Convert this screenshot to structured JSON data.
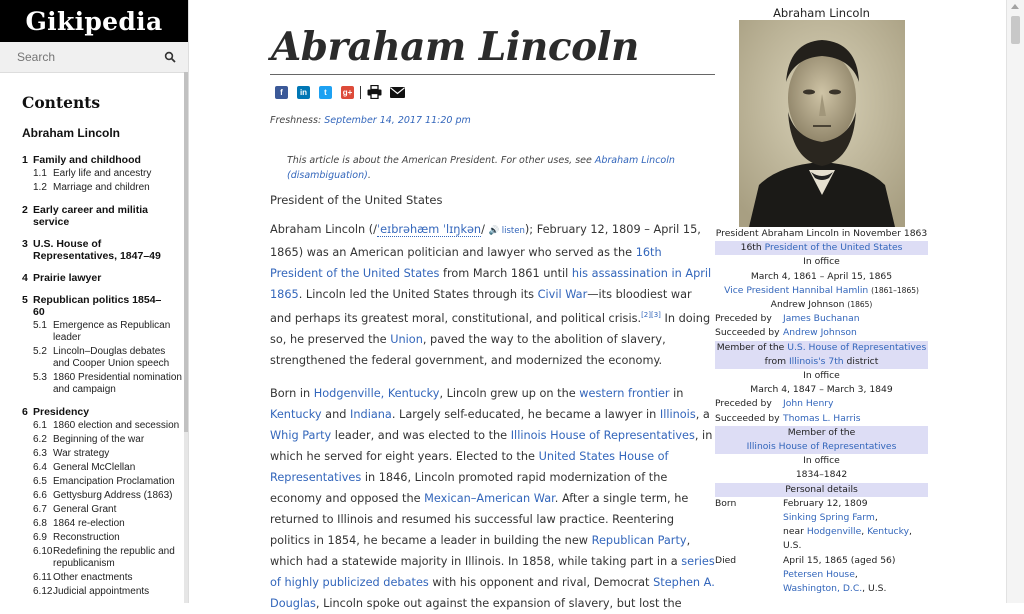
{
  "site": {
    "logo": "Gikipedia"
  },
  "search": {
    "placeholder": "Search"
  },
  "toc": {
    "heading": "Contents",
    "top": "Abraham Lincoln",
    "sections": [
      {
        "num": "1",
        "label": "Family and childhood",
        "subs": [
          {
            "num": "1.1",
            "label": "Early life and ancestry"
          },
          {
            "num": "1.2",
            "label": "Marriage and children"
          }
        ]
      },
      {
        "num": "2",
        "label": "Early career and militia service",
        "subs": []
      },
      {
        "num": "3",
        "label": "U.S. House of Representatives, 1847–49",
        "subs": []
      },
      {
        "num": "4",
        "label": "Prairie lawyer",
        "subs": []
      },
      {
        "num": "5",
        "label": "Republican politics 1854–60",
        "subs": [
          {
            "num": "5.1",
            "label": "Emergence as Republican leader"
          },
          {
            "num": "5.2",
            "label": "Lincoln–Douglas debates and Cooper Union speech"
          },
          {
            "num": "5.3",
            "label": "1860 Presidential nomination and campaign"
          }
        ]
      },
      {
        "num": "6",
        "label": "Presidency",
        "subs": [
          {
            "num": "6.1",
            "label": "1860 election and secession"
          },
          {
            "num": "6.2",
            "label": "Beginning of the war"
          },
          {
            "num": "6.3",
            "label": "War strategy"
          },
          {
            "num": "6.4",
            "label": "General McClellan"
          },
          {
            "num": "6.5",
            "label": "Emancipation Proclamation"
          },
          {
            "num": "6.6",
            "label": "Gettysburg Address (1863)"
          },
          {
            "num": "6.7",
            "label": "General Grant"
          },
          {
            "num": "6.8",
            "label": "1864 re-election"
          },
          {
            "num": "6.9",
            "label": "Reconstruction"
          },
          {
            "num": "6.10",
            "label": "Redefining the republic and republicanism"
          },
          {
            "num": "6.11",
            "label": "Other enactments"
          },
          {
            "num": "6.12",
            "label": "Judicial appointments"
          }
        ]
      }
    ]
  },
  "article": {
    "title": "Abraham Lincoln",
    "share_icons": [
      "facebook-icon",
      "linkedin-icon",
      "twitter-icon",
      "google-plus-icon",
      "print-icon",
      "email-icon"
    ],
    "freshness_label": "Freshness:",
    "freshness_date": "September 14, 2017 11:20 pm",
    "hatnote_text": "This article is about the American President. For other uses, see",
    "hatnote_link": "Abraham Lincoln (disambiguation)",
    "subtitle": "President of the United States",
    "p1": {
      "t1": "Abraham Lincoln (/",
      "ipa": "ˈeɪbrəhæm ˈlɪŋkən",
      "t2": "/ ",
      "listen": "🔊 listen",
      "t3": "); February 12, 1809 – April 15, 1865) was an American politician and lawyer who served as the ",
      "l1": "16th President of the United States",
      "t4": " from March 1861 until ",
      "l2": "his assassination in April 1865",
      "t5": ". Lincoln led the United States through its ",
      "l3": "Civil War",
      "t6": "—its bloodiest war and perhaps its greatest moral, constitutional, and political crisis.",
      "ref": "[2][3]",
      "t7": " In doing so, he preserved the ",
      "l4": "Union",
      "t8": ", paved the way to the abolition of slavery, strengthened the federal government, and modernized the economy."
    },
    "p2": {
      "t1": "Born in ",
      "l1": "Hodgenville, Kentucky",
      "t2": ", Lincoln grew up on the ",
      "l2": "western frontier",
      "t3": " in ",
      "l3": "Kentucky",
      "t4": " and ",
      "l4": "Indiana",
      "t5": ". Largely self-educated, he became a lawyer in ",
      "l5": "Illinois",
      "t6": ", a ",
      "l6": "Whig Party",
      "t7": " leader, and was elected to the ",
      "l7": "Illinois House of Representatives",
      "t8": ", in which he served for eight years. Elected to the ",
      "l8": "United States House of Representatives",
      "t9": " in 1846, Lincoln promoted rapid modernization of the economy and opposed the ",
      "l9": "Mexican–American War",
      "t10": ". After a single term, he returned to Illinois and resumed his successful law practice. Reentering politics in 1854, he became a leader in building the new ",
      "l10": "Republican Party",
      "t11": ", which had a statewide majority in Illinois. In 1858, while taking part in a ",
      "l11": "series of highly publicized debates",
      "t12": " with his opponent and rival, Democrat ",
      "l12": "Stephen A. Douglas",
      "t13": ", Lincoln spoke out against the expansion of slavery, but lost the"
    }
  },
  "infobox": {
    "title": "Abraham Lincoln",
    "caption": "President Abraham Lincoln in November 1863",
    "office1_pre": "16th ",
    "office1_link": "President of the United States",
    "in_office": "In office",
    "term1": "March 4, 1861 – April 15, 1865",
    "vp_label": "Vice President",
    "vp1": "Hannibal Hamlin",
    "vp1_years": "(1861–1865)",
    "vp2": "Andrew Johnson",
    "vp2_years": "(1865)",
    "preceded_label": "Preceded by",
    "succeeded_label": "Succeeded by",
    "pred1": "James Buchanan",
    "succ1": "Andrew Johnson",
    "office2_pre": "Member of the ",
    "office2_link": "U.S. House of Representatives",
    "office2_mid": "from ",
    "office2_link2": "Illinois",
    "office2_link3": "'s 7th",
    "office2_post": " district",
    "term2": "March 4, 1847 – March 3, 1849",
    "pred2": "John Henry",
    "succ2": "Thomas L. Harris",
    "office3_pre": "Member of the",
    "office3_link": "Illinois House of Representatives",
    "term3": "1834–1842",
    "personal": "Personal details",
    "born_label": "Born",
    "born_date": "February 12, 1809",
    "born_place1": "Sinking Spring Farm",
    "born_near": "near ",
    "born_place2": "Hodgenville",
    "born_place3": "Kentucky",
    "born_country": "U.S.",
    "died_label": "Died",
    "died_date": "April 15, 1865 (aged 56)",
    "died_place1": "Petersen House",
    "died_place2": "Washington, D.C.",
    "died_country": "U.S."
  },
  "colors": {
    "link": "#3366bb",
    "band": "#ddddf5",
    "facebook": "#3b5998",
    "linkedin": "#0077b5",
    "twitter": "#1da1f2",
    "google_plus": "#dd4b39"
  }
}
